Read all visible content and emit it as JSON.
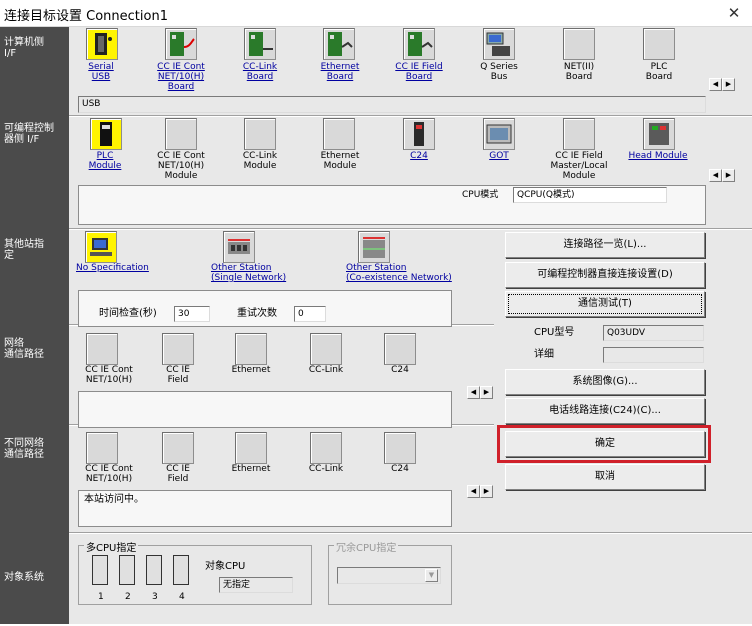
{
  "window": {
    "title": "连接目标设置 Connection1",
    "close": "✕"
  },
  "sidebar": {
    "pc_if": "计算机侧\nI/F",
    "plc_if": "可编程控制\n器侧 I/F",
    "other_station": "其他站指\n定",
    "network_route": "网络\n通信路径",
    "diff_network_route": "不同网络\n通信路径",
    "target_system": "对象系统"
  },
  "pc_interfaces": [
    {
      "label": "Serial\nUSB",
      "icon": "serial-usb-icon",
      "selected": true
    },
    {
      "label": "CC IE Cont\nNET/10(H)\nBoard",
      "icon": "cc-ie-cont-board-icon"
    },
    {
      "label": "CC-Link\nBoard",
      "icon": "cc-link-board-icon"
    },
    {
      "label": "Ethernet\nBoard",
      "icon": "ethernet-board-icon"
    },
    {
      "label": "CC IE Field\nBoard",
      "icon": "cc-ie-field-board-icon"
    },
    {
      "label": "Q Series\nBus",
      "icon": "q-series-bus-icon"
    },
    {
      "label": "NET(II)\nBoard",
      "icon": "net-ii-board-icon"
    },
    {
      "label": "PLC\nBoard",
      "icon": "plc-board-icon"
    }
  ],
  "pc_if_detail": "USB",
  "plc_interfaces": [
    {
      "label": "PLC\nModule",
      "icon": "plc-module-icon",
      "selected": true
    },
    {
      "label": "CC IE Cont\nNET/10(H)\nModule",
      "icon": "cc-ie-cont-module-icon"
    },
    {
      "label": "CC-Link\nModule",
      "icon": "cc-link-module-icon"
    },
    {
      "label": "Ethernet\nModule",
      "icon": "ethernet-module-icon"
    },
    {
      "label": "C24",
      "icon": "c24-icon"
    },
    {
      "label": "GOT",
      "icon": "got-icon"
    },
    {
      "label": "CC IE Field\nMaster/Local\nModule",
      "icon": "cc-ie-field-master-icon"
    },
    {
      "label": "Head Module",
      "icon": "head-module-icon"
    }
  ],
  "cpu_mode": {
    "label": "CPU模式",
    "value": "QCPU(Q模式)"
  },
  "other_stations": [
    {
      "label": "No Specification",
      "icon": "no-specification-icon",
      "selected": true
    },
    {
      "label": "Other Station\n(Single Network)",
      "icon": "other-station-single-icon"
    },
    {
      "label": "Other Station\n(Co-existence Network)",
      "icon": "other-station-coexist-icon"
    }
  ],
  "timing": {
    "check_label": "时间检查(秒)",
    "check_value": "30",
    "retry_label": "重试次数",
    "retry_value": "0"
  },
  "network_routes": [
    {
      "label": "CC IE Cont\nNET/10(H)"
    },
    {
      "label": "CC IE\nField"
    },
    {
      "label": "Ethernet"
    },
    {
      "label": "CC-Link"
    },
    {
      "label": "C24"
    }
  ],
  "diff_network_routes": [
    {
      "label": "CC IE Cont\nNET/10(H)"
    },
    {
      "label": "CC IE\nField"
    },
    {
      "label": "Ethernet"
    },
    {
      "label": "CC-Link"
    },
    {
      "label": "C24"
    }
  ],
  "diff_network_status": "本站访问中。",
  "buttons": {
    "route_list": "连接路径一览(L)...",
    "direct_connect": "可编程控制器直接连接设置(D)",
    "comm_test": "通信测试(T)",
    "system_image": "系统图像(G)...",
    "phone_line": "电话线路连接(C24)(C)...",
    "ok": "确定",
    "cancel": "取消"
  },
  "cpu_info": {
    "model_label": "CPU型号",
    "model_value": "Q03UDV",
    "detail_label": "详细",
    "detail_value": ""
  },
  "multi_cpu": {
    "group_label": "多CPU指定",
    "slots": [
      "1",
      "2",
      "3",
      "4"
    ],
    "target_label": "对象CPU",
    "target_value": "无指定"
  },
  "redundant_cpu": {
    "group_label": "冗余CPU指定",
    "value": ""
  },
  "scroll": {
    "left": "◀",
    "right": "▶",
    "down": "▼"
  },
  "colors": {
    "selected_icon": "#fff400",
    "highlight": "#d0202a",
    "sidebar": "#4b4b4b"
  }
}
